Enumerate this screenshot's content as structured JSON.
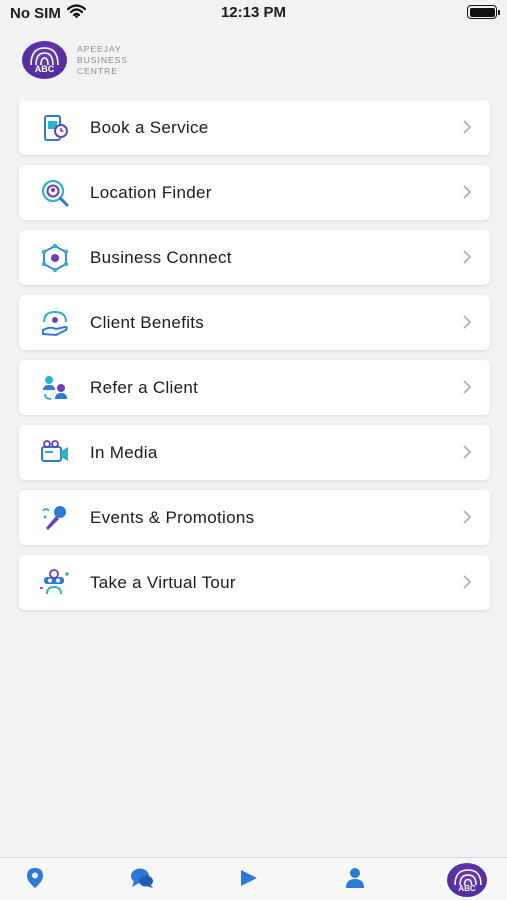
{
  "status_bar": {
    "carrier": "No SIM",
    "time": "12:13 PM"
  },
  "brand": {
    "badge": "ABC",
    "lines": [
      "APEEJAY",
      "BUSINESS",
      "CENTRE"
    ]
  },
  "menu": [
    {
      "label": "Book a Service",
      "icon": "calendar-phone-icon"
    },
    {
      "label": "Location Finder",
      "icon": "location-search-icon"
    },
    {
      "label": "Business Connect",
      "icon": "network-icon"
    },
    {
      "label": "Client Benefits",
      "icon": "hand-benefit-icon"
    },
    {
      "label": "Refer a Client",
      "icon": "refer-people-icon"
    },
    {
      "label": "In Media",
      "icon": "video-camera-icon"
    },
    {
      "label": "Events & Promotions",
      "icon": "microphone-icon"
    },
    {
      "label": "Take a Virtual Tour",
      "icon": "virtual-tour-icon"
    }
  ],
  "tab_bar": {
    "items": [
      "location-pin-icon",
      "chat-icon",
      "play-icon",
      "profile-icon",
      "abc-logo-icon"
    ],
    "abc_label": "ABC"
  },
  "colors": {
    "accent": "#2a7ad6",
    "brand_purple": "#5a2fa5",
    "icon_teal": "#2bb3c9"
  }
}
